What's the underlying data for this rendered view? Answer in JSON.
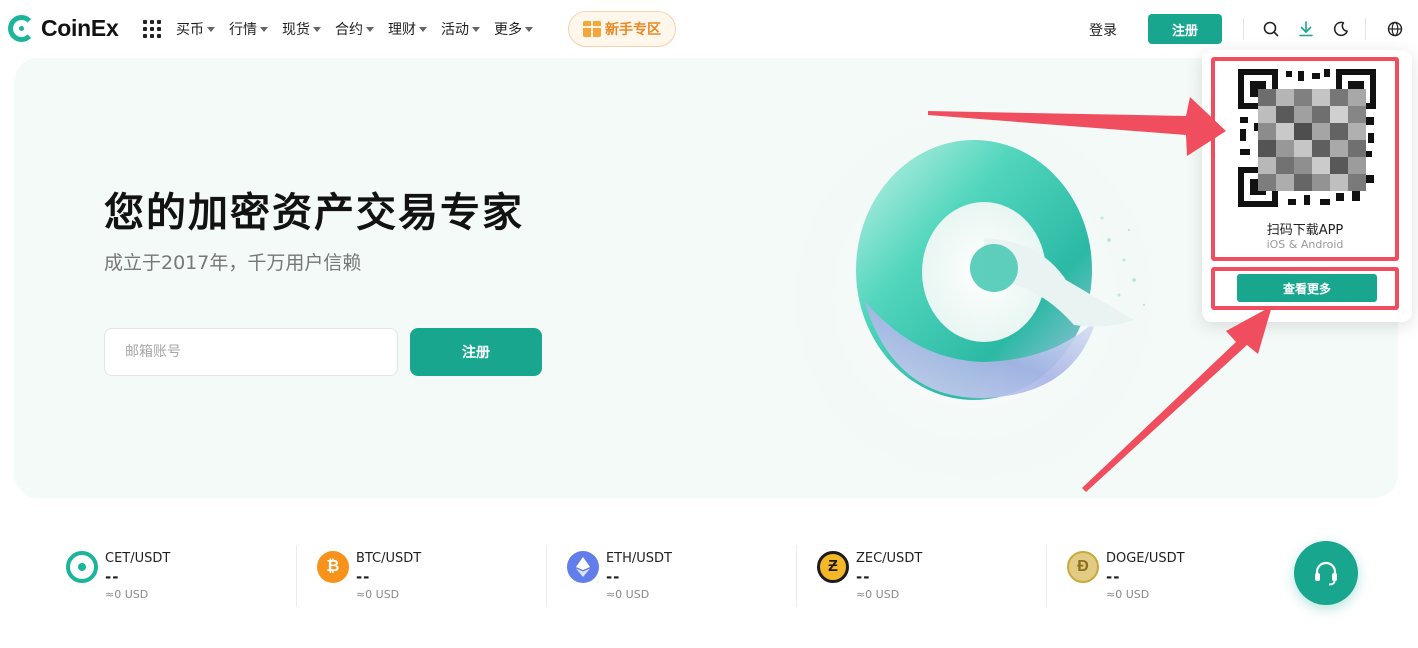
{
  "logo": {
    "text": "CoinEx"
  },
  "nav": {
    "items": [
      {
        "label": "买币"
      },
      {
        "label": "行情"
      },
      {
        "label": "现货"
      },
      {
        "label": "合约"
      },
      {
        "label": "理财"
      },
      {
        "label": "活动"
      },
      {
        "label": "更多"
      }
    ],
    "newbie_label": "新手专区",
    "login_label": "登录",
    "register_label": "注册"
  },
  "header_icons": [
    "search-icon",
    "download-icon",
    "moon-icon",
    "globe-icon"
  ],
  "hero": {
    "title": "您的加密资产交易专家",
    "subtitle": "成立于2017年，千万用户信赖",
    "email_placeholder": "邮箱账号",
    "register_label": "注册"
  },
  "download_popup": {
    "scan_label": "扫码下载APP",
    "platforms": "iOS & Android",
    "more_label": "查看更多"
  },
  "tickers": [
    {
      "pair": "CET/USDT",
      "price": "--",
      "usd": "≈0 USD",
      "icon": "cet-icon",
      "color": "#1bb59b"
    },
    {
      "pair": "BTC/USDT",
      "price": "--",
      "usd": "≈0 USD",
      "icon": "btc-icon",
      "color": "#f7931a"
    },
    {
      "pair": "ETH/USDT",
      "price": "--",
      "usd": "≈0 USD",
      "icon": "eth-icon",
      "color": "#627eea"
    },
    {
      "pair": "ZEC/USDT",
      "price": "--",
      "usd": "≈0 USD",
      "icon": "zec-icon",
      "color": "#1c1c1c"
    },
    {
      "pair": "DOGE/USDT",
      "price": "--",
      "usd": "≈0 USD",
      "icon": "doge-icon",
      "color": "#c9a93a"
    }
  ],
  "colors": {
    "brand": "#18a78e",
    "highlight": "#f04e5e",
    "accent_orange": "#e88a24"
  }
}
